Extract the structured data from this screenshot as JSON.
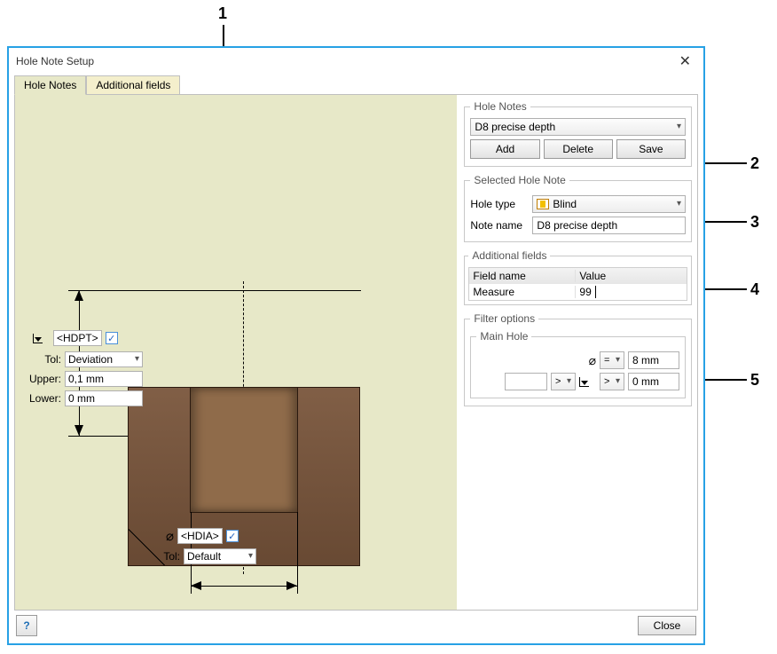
{
  "title": "Hole Note Setup",
  "tabs": {
    "holeNotes": "Hole Notes",
    "additional": "Additional fields"
  },
  "holeNotes": {
    "legend": "Hole Notes",
    "selected": "D8 precise depth",
    "add": "Add",
    "delete": "Delete",
    "save": "Save"
  },
  "selectedHoleNote": {
    "legend": "Selected Hole Note",
    "holeTypeLabel": "Hole type",
    "holeType": "Blind",
    "noteNameLabel": "Note name",
    "noteName": "D8 precise depth"
  },
  "addFields": {
    "legend": "Additional fields",
    "colField": "Field name",
    "colValue": "Value",
    "rows": [
      {
        "name": "Measure",
        "value": "99"
      }
    ]
  },
  "filter": {
    "legend": "Filter options",
    "mainLegend": "Main Hole",
    "diam": "8 mm",
    "diamOp": "=",
    "depth": "0 mm",
    "gt": ">"
  },
  "overlay": {
    "hdpt": "<HDPT>",
    "tolLabel": "Tol:",
    "tolMode": "Deviation",
    "upperLabel": "Upper:",
    "upper": "0,1 mm",
    "lowerLabel": "Lower:",
    "lower": "0 mm",
    "hdia": "<HDIA>",
    "tolDefault": "Default"
  },
  "footer": {
    "help": "?",
    "close": "Close"
  },
  "callouts": {
    "c1": "1",
    "c2": "2",
    "c3": "3",
    "c4": "4",
    "c5": "5"
  }
}
